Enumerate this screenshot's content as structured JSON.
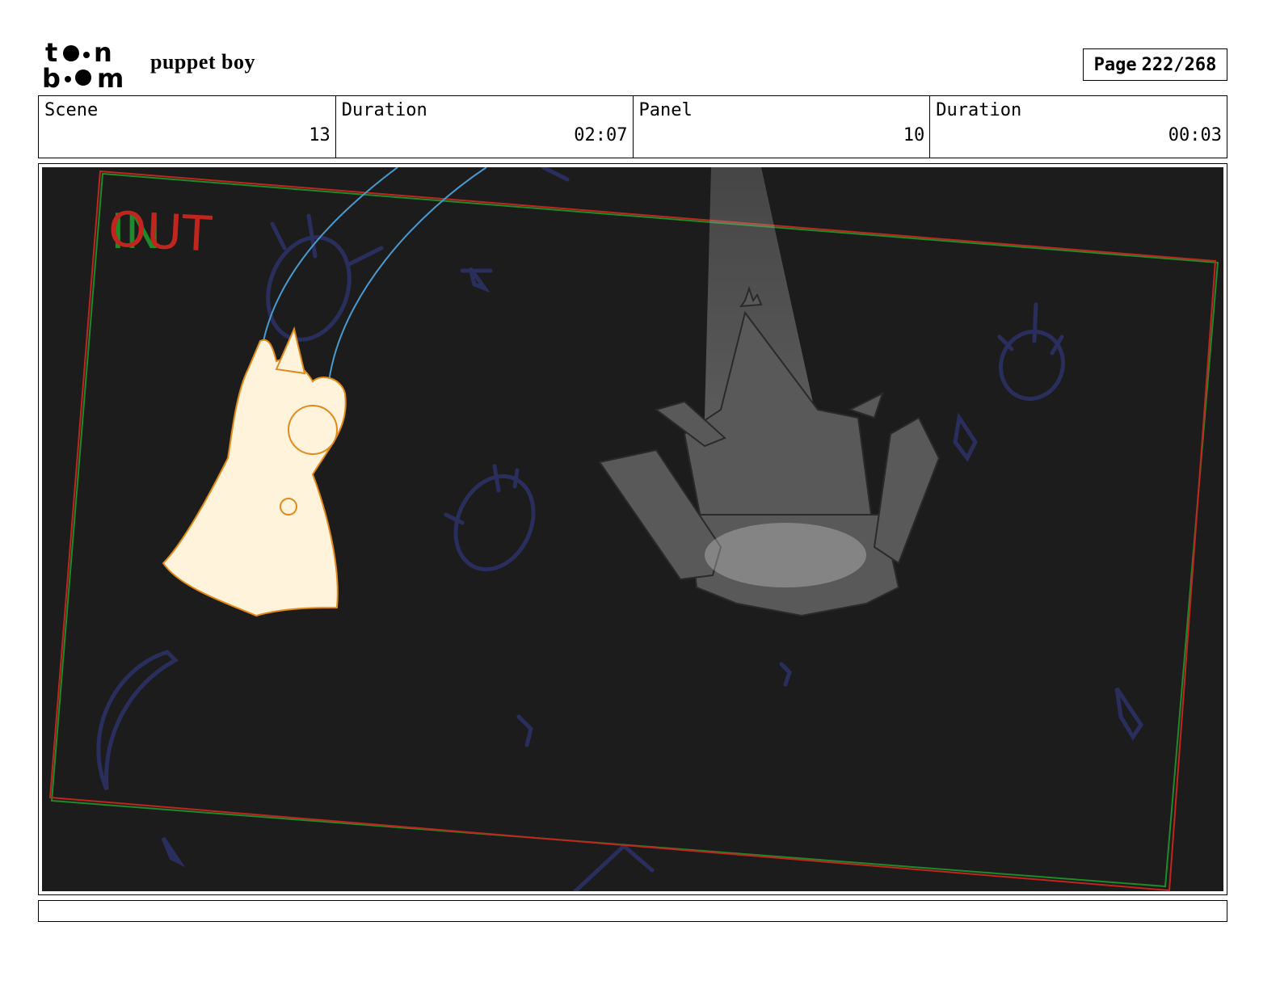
{
  "header": {
    "logo_text_top": "toon",
    "logo_text_bottom": "boom",
    "project_title": "puppet boy",
    "page_label": "Page",
    "page_number": "222/268"
  },
  "info": {
    "scene_label": "Scene",
    "scene_value": "13",
    "scene_duration_label": "Duration",
    "scene_duration_value": "02:07",
    "panel_label": "Panel",
    "panel_value": "10",
    "panel_duration_label": "Duration",
    "panel_duration_value": "00:03"
  },
  "panel": {
    "in_marker": "IN",
    "out_marker": "OUT",
    "colors": {
      "background": "#1c1c1c",
      "camera_frame_red": "#c0261e",
      "camera_frame_green": "#1e8a2a",
      "doodles": "#2a2e5c",
      "puppet_strings": "#4a9ad0",
      "puppet_fill": "#fff3dc",
      "puppet_line": "#e08a1a",
      "theater_gray": "#595959"
    }
  },
  "notes": {
    "text": ""
  }
}
